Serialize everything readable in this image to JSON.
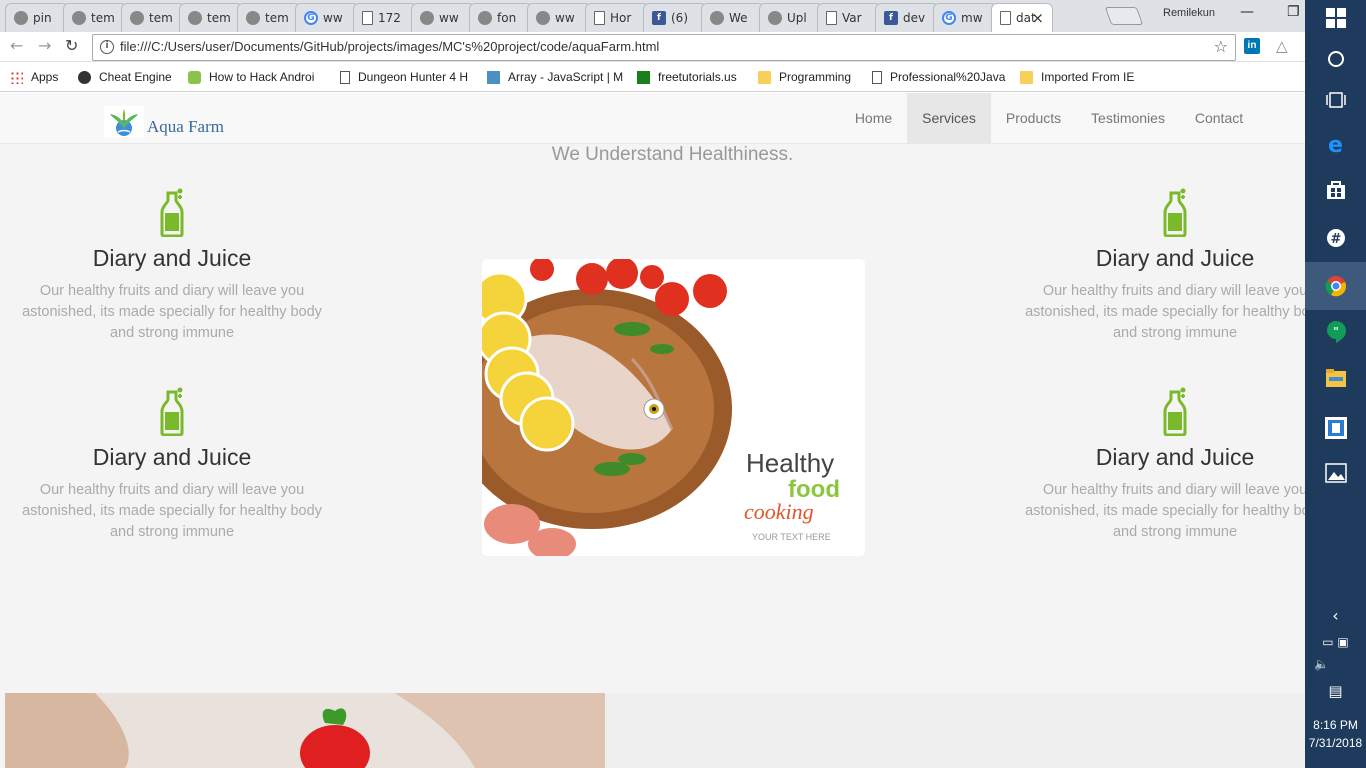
{
  "browser": {
    "tabs": [
      {
        "label": "pin",
        "icon": "gray"
      },
      {
        "label": "tem",
        "icon": "gray"
      },
      {
        "label": "tem",
        "icon": "gray"
      },
      {
        "label": "tem",
        "icon": "gray"
      },
      {
        "label": "tem",
        "icon": "gray"
      },
      {
        "label": "ww",
        "icon": "g"
      },
      {
        "label": "172",
        "icon": "doc"
      },
      {
        "label": "ww",
        "icon": "gray"
      },
      {
        "label": "fon",
        "icon": "gray"
      },
      {
        "label": "ww",
        "icon": "gray"
      },
      {
        "label": "Hor",
        "icon": "doc"
      },
      {
        "label": "(6)",
        "icon": "fb"
      },
      {
        "label": "We",
        "icon": "gray"
      },
      {
        "label": "Upl",
        "icon": "gray"
      },
      {
        "label": "Var",
        "icon": "doc"
      },
      {
        "label": "dev",
        "icon": "fb"
      },
      {
        "label": "mw",
        "icon": "g"
      },
      {
        "label": "dat",
        "icon": "doc"
      }
    ],
    "active_tab_close": "×",
    "user": "Remilekun",
    "url": "file:///C:/Users/user/Documents/GitHub/projects/images/MC's%20project/code/aquaFarm.html",
    "bookmarks": [
      {
        "label": "Apps",
        "icon": "apps"
      },
      {
        "label": "Cheat Engine",
        "icon": "gear"
      },
      {
        "label": "How to Hack Androi",
        "icon": "green"
      },
      {
        "label": "Dungeon Hunter 4 H",
        "icon": "doc"
      },
      {
        "label": "Array - JavaScript | M",
        "icon": "blue"
      },
      {
        "label": "freetutorials.us",
        "icon": "ftu"
      },
      {
        "label": "Programming",
        "icon": "folder"
      },
      {
        "label": "Professional%20Java",
        "icon": "doc"
      },
      {
        "label": "Imported From IE",
        "icon": "folder"
      }
    ]
  },
  "site": {
    "brand": "Aqua Farm",
    "nav": [
      "Home",
      "Services",
      "Products",
      "Testimonies",
      "Contact"
    ],
    "active_nav": "Services",
    "tagline": "We Understand Healthiness.",
    "features": [
      {
        "title": "Diary and Juice",
        "desc": "Our healthy fruits and diary will leave you astonished, its made specially for healthy body and strong immune"
      },
      {
        "title": "Diary and Juice",
        "desc": "Our healthy fruits and diary will leave you astonished, its made specially for healthy body and strong immune"
      },
      {
        "title": "Diary and Juice",
        "desc": "Our healthy fruits and diary will leave you astonished, its made specially for healthy body and strong immune"
      },
      {
        "title": "Diary and Juice",
        "desc": "Our healthy fruits and diary will leave you astonished, its made specially for healthy body and strong immune"
      }
    ],
    "image_text": {
      "healthy": "Healthy",
      "food": "food",
      "cooking": "cooking",
      "sub": "YOUR TEXT HERE"
    },
    "accent_green": "#7ab929"
  },
  "taskbar": {
    "time": "8:16 PM",
    "date": "7/31/2018"
  }
}
